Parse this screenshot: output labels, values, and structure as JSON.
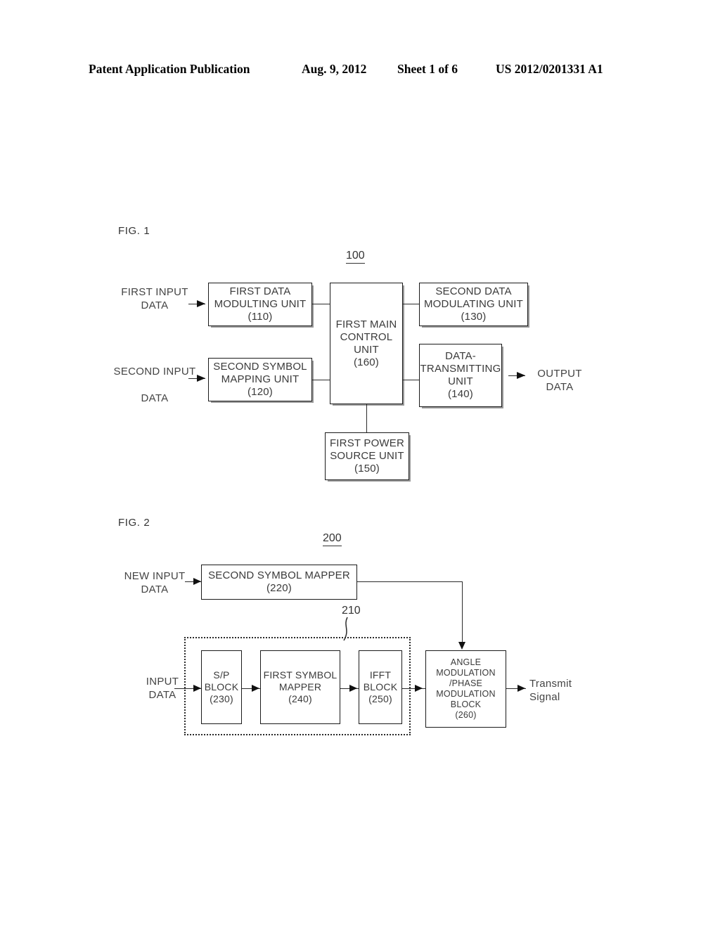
{
  "header": {
    "publication": "Patent Application Publication",
    "date": "Aug. 9, 2012",
    "sheet": "Sheet 1 of 6",
    "docnumber": "US 2012/0201331 A1"
  },
  "figures": [
    {
      "label": "FIG. 1",
      "ref": "100",
      "inputs": [
        {
          "name": "first-input-data",
          "text": "FIRST INPUT\nDATA"
        },
        {
          "name": "second-input-data",
          "text": "SECOND INPUT\n\nDATA"
        }
      ],
      "outputs": [
        {
          "name": "output-data",
          "text": "OUTPUT\nDATA"
        }
      ],
      "blocks": [
        {
          "id": "110",
          "name": "first-data-modulting-unit",
          "text": "FIRST DATA\nMODULTING UNIT\n(110)"
        },
        {
          "id": "120",
          "name": "second-symbol-mapping-unit",
          "text": "SECOND SYMBOL\nMAPPING UNIT\n(120)"
        },
        {
          "id": "130",
          "name": "second-data-modulating-unit",
          "text": "SECOND DATA\nMODULATING UNIT\n(130)"
        },
        {
          "id": "140",
          "name": "data-transmitting-unit",
          "text": "DATA-\nTRANSMITTING\nUNIT\n(140)"
        },
        {
          "id": "150",
          "name": "first-power-source-unit",
          "text": "FIRST POWER\nSOURCE UNIT\n(150)"
        },
        {
          "id": "160",
          "name": "first-main-control-unit",
          "text": "FIRST MAIN\nCONTROL\nUNIT\n(160)"
        }
      ]
    },
    {
      "label": "FIG. 2",
      "ref": "200",
      "ref_inner": "210",
      "inputs": [
        {
          "name": "new-input-data",
          "text": "NEW INPUT\nDATA"
        },
        {
          "name": "input-data",
          "text": "INPUT\nDATA"
        }
      ],
      "outputs": [
        {
          "name": "transmit-signal",
          "text": "Transmit\nSignal"
        }
      ],
      "blocks": [
        {
          "id": "220",
          "name": "second-symbol-mapper",
          "text": "SECOND SYMBOL MAPPER\n(220)"
        },
        {
          "id": "230",
          "name": "sp-block",
          "text": "S/P\nBLOCK\n(230)"
        },
        {
          "id": "240",
          "name": "first-symbol-mapper",
          "text": "FIRST SYMBOL\nMAPPER\n(240)"
        },
        {
          "id": "250",
          "name": "ifft-block",
          "text": "IFFT\nBLOCK\n(250)"
        },
        {
          "id": "260",
          "name": "angle-phase-modulation-block",
          "text": "ANGLE MODULATION\n/PHASE MODULATION\nBLOCK\n(260)"
        }
      ]
    }
  ]
}
